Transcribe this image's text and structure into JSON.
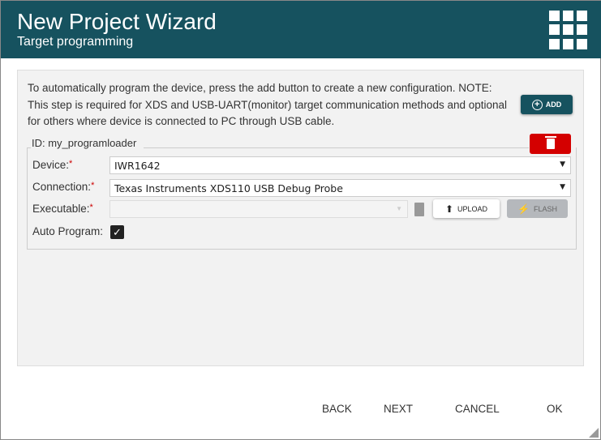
{
  "header": {
    "title": "New Project Wizard",
    "subtitle": "Target programming"
  },
  "note": "To automatically program the device, press the add button to create a new configuration. NOTE: This step is required for XDS and USB-UART(monitor) target communication methods and optional for others where device is connected to PC through USB cable.",
  "add_label": "ADD",
  "config": {
    "id_label": "ID: my_programloader",
    "device_label": "Device:",
    "device_value": "IWR1642",
    "connection_label": "Connection:",
    "connection_value": "Texas Instruments XDS110 USB Debug Probe",
    "executable_label": "Executable:",
    "executable_value": "",
    "upload_label": "UPLOAD",
    "flash_label": "FLASH",
    "auto_program_label": "Auto Program:",
    "auto_program": true
  },
  "footer": {
    "back": "BACK",
    "next": "NEXT",
    "cancel": "CANCEL",
    "ok": "OK"
  }
}
